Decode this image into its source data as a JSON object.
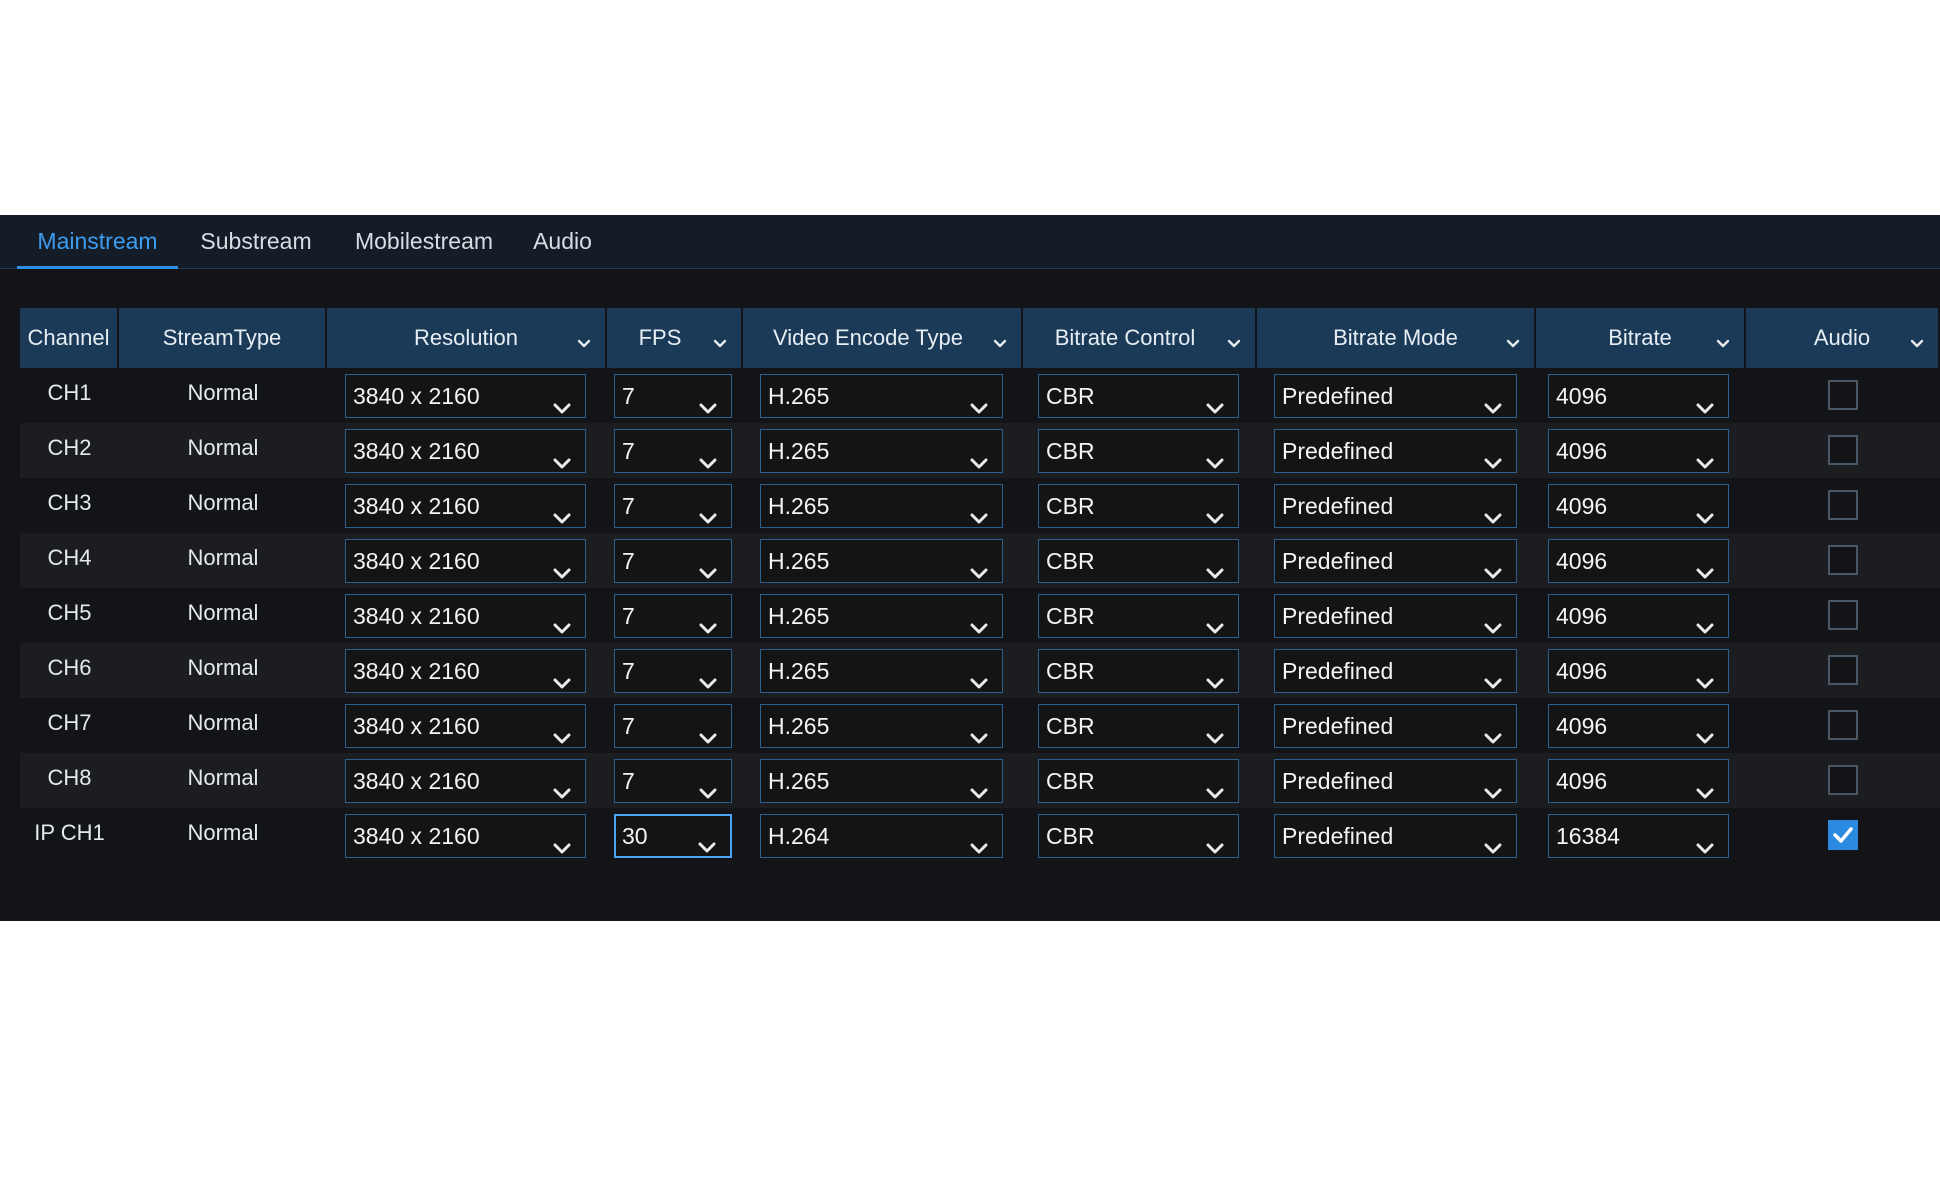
{
  "tabs": [
    {
      "label": "Mainstream",
      "active": true
    },
    {
      "label": "Substream",
      "active": false
    },
    {
      "label": "Mobilestream",
      "active": false
    },
    {
      "label": "Audio",
      "active": false
    }
  ],
  "table": {
    "headers": {
      "channel": "Channel",
      "stream_type": "StreamType",
      "resolution": "Resolution",
      "fps": "FPS",
      "video_encode_type": "Video Encode Type",
      "bitrate_control": "Bitrate Control",
      "bitrate_mode": "Bitrate Mode",
      "bitrate": "Bitrate",
      "audio": "Audio"
    },
    "rows": [
      {
        "channel": "CH1",
        "stream_type": "Normal",
        "resolution": "3840 x 2160",
        "fps": "7",
        "encode": "H.265",
        "bitrate_control": "CBR",
        "bitrate_mode": "Predefined",
        "bitrate": "4096",
        "audio": false
      },
      {
        "channel": "CH2",
        "stream_type": "Normal",
        "resolution": "3840 x 2160",
        "fps": "7",
        "encode": "H.265",
        "bitrate_control": "CBR",
        "bitrate_mode": "Predefined",
        "bitrate": "4096",
        "audio": false
      },
      {
        "channel": "CH3",
        "stream_type": "Normal",
        "resolution": "3840 x 2160",
        "fps": "7",
        "encode": "H.265",
        "bitrate_control": "CBR",
        "bitrate_mode": "Predefined",
        "bitrate": "4096",
        "audio": false
      },
      {
        "channel": "CH4",
        "stream_type": "Normal",
        "resolution": "3840 x 2160",
        "fps": "7",
        "encode": "H.265",
        "bitrate_control": "CBR",
        "bitrate_mode": "Predefined",
        "bitrate": "4096",
        "audio": false
      },
      {
        "channel": "CH5",
        "stream_type": "Normal",
        "resolution": "3840 x 2160",
        "fps": "7",
        "encode": "H.265",
        "bitrate_control": "CBR",
        "bitrate_mode": "Predefined",
        "bitrate": "4096",
        "audio": false
      },
      {
        "channel": "CH6",
        "stream_type": "Normal",
        "resolution": "3840 x 2160",
        "fps": "7",
        "encode": "H.265",
        "bitrate_control": "CBR",
        "bitrate_mode": "Predefined",
        "bitrate": "4096",
        "audio": false
      },
      {
        "channel": "CH7",
        "stream_type": "Normal",
        "resolution": "3840 x 2160",
        "fps": "7",
        "encode": "H.265",
        "bitrate_control": "CBR",
        "bitrate_mode": "Predefined",
        "bitrate": "4096",
        "audio": false
      },
      {
        "channel": "CH8",
        "stream_type": "Normal",
        "resolution": "3840 x 2160",
        "fps": "7",
        "encode": "H.265",
        "bitrate_control": "CBR",
        "bitrate_mode": "Predefined",
        "bitrate": "4096",
        "audio": false
      },
      {
        "channel": "IP CH1",
        "stream_type": "Normal",
        "resolution": "3840 x 2160",
        "fps": "30",
        "encode": "H.264",
        "bitrate_control": "CBR",
        "bitrate_mode": "Predefined",
        "bitrate": "16384",
        "audio": true
      }
    ]
  },
  "colors": {
    "panel_bg": "#121417",
    "header_bg": "#1b3a58",
    "accent": "#2f8fe6",
    "active_tab_text": "#3d9cf0",
    "select_border": "#2d5f8e"
  }
}
